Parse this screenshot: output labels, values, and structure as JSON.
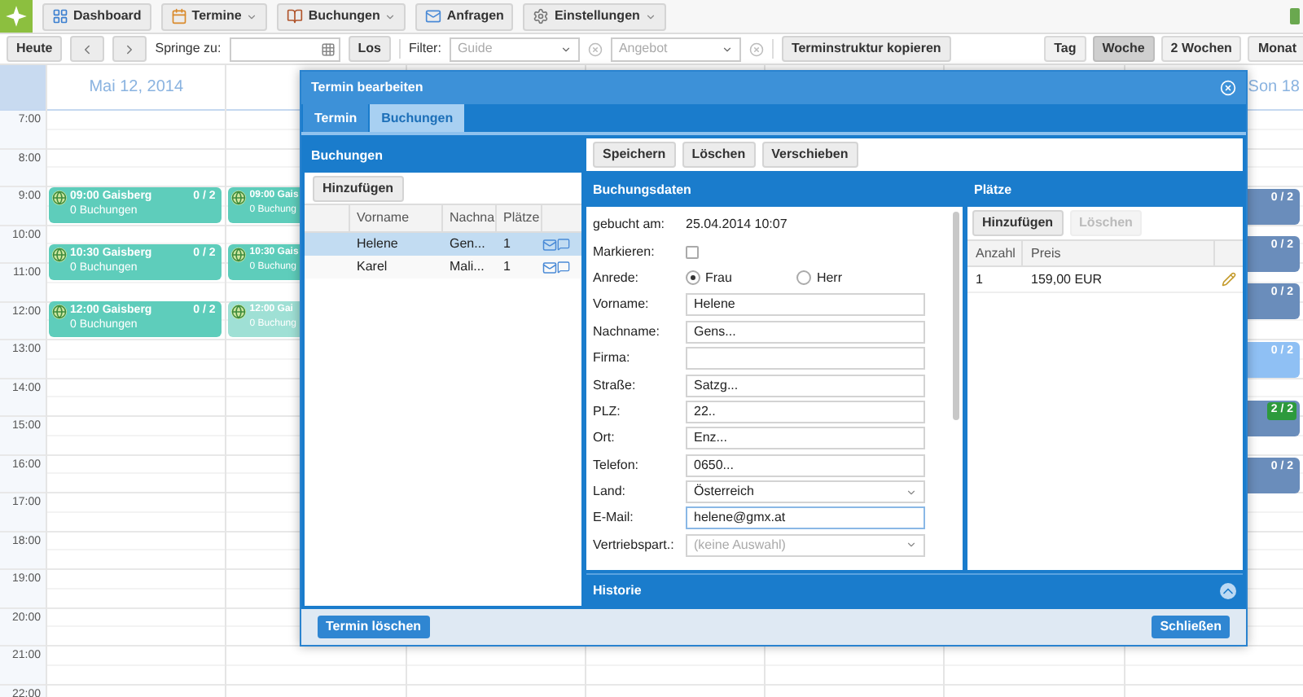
{
  "nav": {
    "items": [
      {
        "label": "Dashboard",
        "kind": "plain"
      },
      {
        "label": "Termine",
        "kind": "menu"
      },
      {
        "label": "Buchungen",
        "kind": "menu"
      },
      {
        "label": "Anfragen",
        "kind": "plain"
      },
      {
        "label": "Einstellungen",
        "kind": "menu"
      }
    ]
  },
  "toolbar": {
    "today": "Heute",
    "jump_label": "Springe zu:",
    "go": "Los",
    "filter_label": "Filter:",
    "filters": [
      {
        "placeholder": "Guide"
      },
      {
        "placeholder": "Angebot"
      }
    ],
    "copy": "Terminstruktur kopieren",
    "views": [
      {
        "label": "Tag",
        "selected": false
      },
      {
        "label": "Woche",
        "selected": true
      },
      {
        "label": "2 Wochen",
        "selected": false
      },
      {
        "label": "Monat",
        "selected": false
      }
    ]
  },
  "calendar": {
    "times": [
      "7:00",
      "8:00",
      "9:00",
      "10:00",
      "11:00",
      "12:00",
      "13:00",
      "14:00",
      "15:00",
      "16:00",
      "17:00",
      "18:00",
      "19:00",
      "20:00",
      "21:00",
      "22:00"
    ],
    "days": [
      {
        "header": "Mai 12, 2014",
        "events": [
          {
            "title": "09:00 Gaisberg",
            "bookings": "0 Buchungen",
            "count": "0 / 2",
            "color": "#5ecdbb"
          },
          {
            "title": "10:30 Gaisberg",
            "bookings": "0 Buchungen",
            "count": "0 / 2",
            "color": "#5ecdbb"
          },
          {
            "title": "12:00 Gaisberg",
            "bookings": "0 Buchungen",
            "count": "0 / 2",
            "color": "#5ecdbb"
          }
        ]
      },
      {
        "events": [
          {
            "title": "09:00 Gais",
            "bookings": "0 Buchung",
            "color": "#5ecdbb"
          },
          {
            "title": "10:30 Gais",
            "bookings": "0 Buchung",
            "color": "#5ecdbb"
          },
          {
            "title": "12:00 Gai",
            "bookings": "0 Buchung",
            "color": "#9fe0d5"
          }
        ]
      },
      {
        "header": "Son 18",
        "events": [
          {
            "count": "0 / 2",
            "color": "#6a8dbb",
            "full": false
          },
          {
            "count": "0 / 2",
            "color": "#6a8dbb",
            "full": false
          },
          {
            "count": "0 / 2",
            "color": "#6a8dbb",
            "full": false
          },
          {
            "count": "0 / 2",
            "color": "#8fc0f4",
            "full": false
          },
          {
            "count": "2 / 2",
            "color": "#6a8dbb",
            "full": true
          },
          {
            "count": "0 / 2",
            "color": "#6a8dbb",
            "full": false
          }
        ]
      }
    ]
  },
  "dialog": {
    "title": "Termin bearbeiten",
    "tabs": [
      {
        "label": "Termin",
        "selected": false
      },
      {
        "label": "Buchungen",
        "selected": true
      }
    ],
    "bookings": {
      "title": "Buchungen",
      "add": "Hinzufügen",
      "columns": [
        "Vorname",
        "Nachna",
        "Plätze"
      ],
      "rows": [
        {
          "first": "Helene",
          "last": "Gen...",
          "seats": "1",
          "selected": true
        },
        {
          "first": "Karel",
          "last": "Mali...",
          "seats": "1",
          "selected": false
        }
      ]
    },
    "actions": [
      {
        "label": "Speichern"
      },
      {
        "label": "Löschen"
      },
      {
        "label": "Verschieben"
      }
    ],
    "details": {
      "title": "Buchungsdaten",
      "fields": [
        {
          "kind": "text",
          "label": "gebucht am:",
          "value": "25.04.2014 10:07"
        },
        {
          "kind": "checkbox",
          "label": "Markieren:",
          "checked": false
        },
        {
          "kind": "radio",
          "label": "Anrede:",
          "options": [
            {
              "label": "Frau",
              "selected": true
            },
            {
              "label": "Herr",
              "selected": false
            }
          ]
        },
        {
          "kind": "input",
          "label": "Vorname:",
          "value": "Helene",
          "focused": false
        },
        {
          "kind": "input",
          "label": "Nachname:",
          "value": "Gens...",
          "focused": false
        },
        {
          "kind": "input",
          "label": "Firma:",
          "focused": false
        },
        {
          "kind": "input",
          "label": "Straße:",
          "value": "Satzg...",
          "focused": false
        },
        {
          "kind": "input",
          "label": "PLZ:",
          "value": "22..",
          "focused": false
        },
        {
          "kind": "input",
          "label": "Ort:",
          "value": "Enz...",
          "focused": false
        },
        {
          "kind": "input",
          "label": "Telefon:",
          "value": "0650...",
          "focused": false
        },
        {
          "kind": "select",
          "label": "Land:",
          "value": "Österreich"
        },
        {
          "kind": "input",
          "label": "E-Mail:",
          "value": "helene@gmx.at",
          "focused": true
        },
        {
          "kind": "select",
          "label": "Vertriebspart.:",
          "placeholder": "(keine Auswahl)"
        }
      ]
    },
    "seats": {
      "title": "Plätze",
      "buttons": [
        {
          "label": "Hinzufügen",
          "disabled": false
        },
        {
          "label": "Löschen",
          "disabled": true
        }
      ],
      "columns": [
        "Anzahl",
        "Preis"
      ],
      "rows": [
        {
          "count": "1",
          "price": "159,00 EUR"
        }
      ]
    },
    "history": {
      "title": "Historie"
    },
    "delete": "Termin löschen",
    "close": "Schließen"
  }
}
